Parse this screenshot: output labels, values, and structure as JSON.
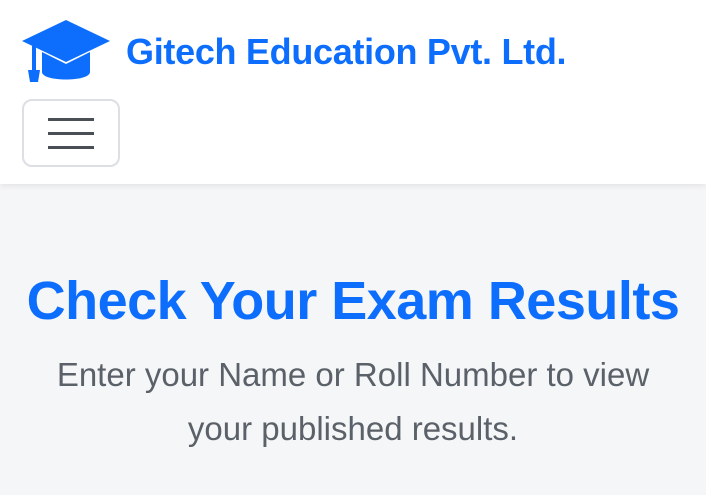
{
  "header": {
    "brand_name": "Gitech Education Pvt. Ltd.",
    "brand_icon": "graduation-cap-icon",
    "menu_icon": "hamburger-menu-icon"
  },
  "hero": {
    "title": "Check Your Exam Results",
    "subtitle": "Enter your Name or Roll Number to view your published results."
  },
  "colors": {
    "accent": "#0d6efd",
    "text_muted": "#5b6168",
    "background": "#f5f6f8"
  }
}
